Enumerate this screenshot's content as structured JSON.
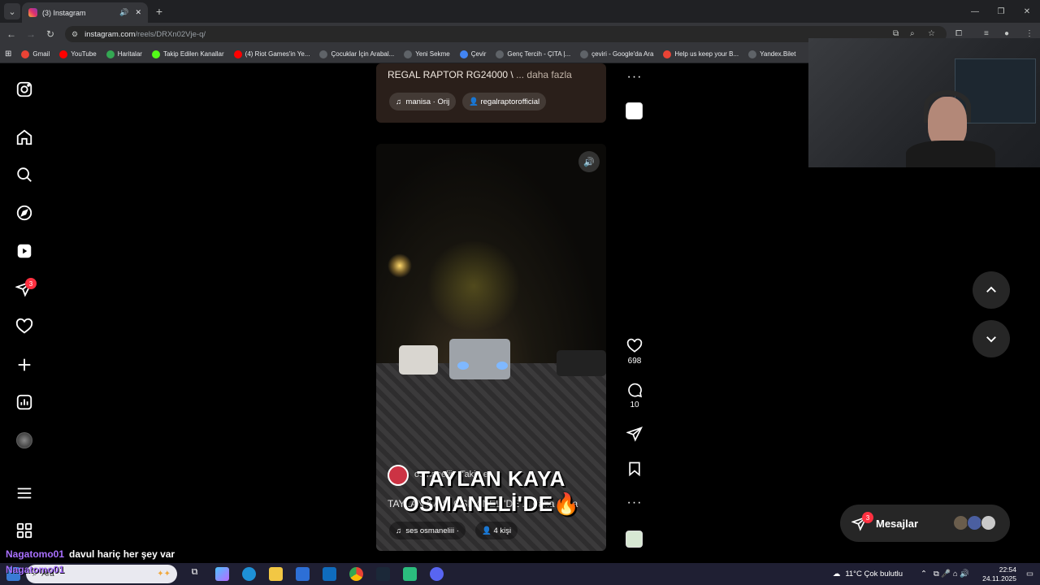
{
  "browser": {
    "tab_title": "(3) Instagram",
    "url_host": "instagram.com",
    "url_path": "/reels/DRXn02Vje-q/",
    "bookmarks": [
      {
        "label": "Gmail",
        "color": "#ea4335",
        "glyph": "M"
      },
      {
        "label": "YouTube",
        "color": "#ff0000",
        "glyph": "▶"
      },
      {
        "label": "Haritalar",
        "color": "#34a853",
        "glyph": "◆"
      },
      {
        "label": "Takip Edilen Kanallar",
        "color": "#53fc18",
        "glyph": "K"
      },
      {
        "label": "(4) Riot Games'in Ye...",
        "color": "#ff0000",
        "glyph": "▶"
      },
      {
        "label": "Çocuklar İçin Arabal...",
        "color": "#5f6368",
        "glyph": "G"
      },
      {
        "label": "Yeni Sekme",
        "color": "#5f6368",
        "glyph": "◎"
      },
      {
        "label": "Çevir",
        "color": "#4285f4",
        "glyph": "文"
      },
      {
        "label": "Genç Tercih - ÇITA |...",
        "color": "#5f6368",
        "glyph": "◎"
      },
      {
        "label": "çeviri - Google'da Ara",
        "color": "#5f6368",
        "glyph": "G"
      },
      {
        "label": "Help us keep your B...",
        "color": "#ea4335",
        "glyph": "M"
      },
      {
        "label": "Yandex.Bilet",
        "color": "#5f6368",
        "glyph": "◎"
      }
    ]
  },
  "sidebar": {
    "notification_count": "3",
    "icons": [
      "instagram-icon",
      "home-icon",
      "search-icon",
      "explore-icon",
      "reels-icon",
      "messages-icon",
      "heart-icon",
      "create-icon",
      "dashboard-icon",
      "profile-avatar",
      "menu-icon",
      "more-apps-icon"
    ]
  },
  "reel_top": {
    "caption": "REGAL RAPTOR RG24000 \\",
    "more": " ... daha fazla",
    "audio": "manisa · Orij",
    "user": "regalraptorofficial"
  },
  "reel_main": {
    "overlay_line1": "TAYLAN KAYA",
    "overlay_line2": "OSMANELİ'DE🔥",
    "username": "osmanelii · Takip et",
    "caption": "TAYLAN KAYA OSMANELİ'DE ... daha fazla",
    "audio": "ses  osmaneliii ·",
    "people": "4 kişi",
    "likes": "698",
    "comments": "10"
  },
  "messages": {
    "label": "Mesajlar",
    "badge": "3"
  },
  "chat": [
    {
      "user": "Nagatomo01",
      "message": "davul hariç her şey var"
    },
    {
      "user": "Nagatomo01",
      "message": ""
    }
  ],
  "taskbar": {
    "search_placeholder": "Ara",
    "weather": "11°C  Çok bulutlu",
    "time": "22:54",
    "date": "24.11.2025"
  }
}
